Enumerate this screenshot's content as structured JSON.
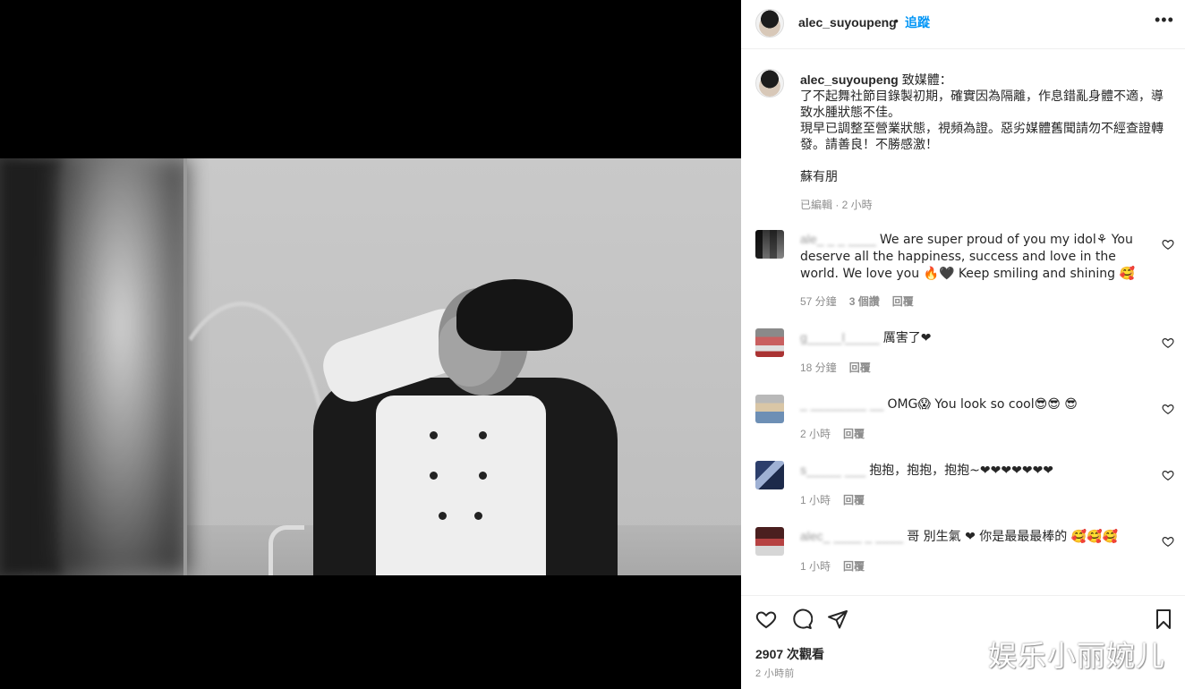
{
  "post": {
    "username": "alec_suyoupeng",
    "dot": "•",
    "follow_label": "追蹤",
    "more_label": "•••"
  },
  "caption": {
    "username": "alec_suyoupeng",
    "lines": [
      "致媒體：",
      "了不起舞社節目錄製初期，確實因為隔離，作息錯亂身體不適，導致水腫狀態不佳。",
      "現早已調整至營業狀態，視頻為證。惡劣媒體舊聞請勿不經查證轉發。請善良！不勝感激！",
      "",
      "蘇有朋"
    ],
    "meta": "已編輯 · 2 小時"
  },
  "comments": [
    {
      "name": "ale_ _ _ ____",
      "text": "We are super proud of you my idol⚘ You deserve all the happiness, success and love in the world. We love you 🔥🖤 Keep smiling and shining 🥰",
      "time": "57 分鐘",
      "likes": "3 個讚",
      "reply": "回覆"
    },
    {
      "name": "g_____l_____",
      "text": "厲害了❤",
      "time": "18 分鐘",
      "likes": "",
      "reply": "回覆"
    },
    {
      "name": "_ ________ __",
      "text": "OMG😱 You look so cool😎😎 😎",
      "time": "2 小時",
      "likes": "",
      "reply": "回覆"
    },
    {
      "name": "s_____ ___",
      "text": "抱抱，抱抱，抱抱~❤❤❤❤❤❤❤",
      "time": "1 小時",
      "likes": "",
      "reply": "回覆"
    },
    {
      "name": "alec_ ____ _ ____",
      "text": "哥 別生氣 ❤ 你是最最最棒的 🥰🥰🥰",
      "time": "1 小時",
      "likes": "",
      "reply": "回覆"
    }
  ],
  "actions": {
    "like_icon": "heart-icon",
    "comment_icon": "comment-icon",
    "share_icon": "share-icon",
    "save_icon": "bookmark-icon",
    "views": "2907 次觀看",
    "posted": "2 小時前"
  },
  "watermark": "娱乐小丽婉儿",
  "colors": {
    "accent": "#0095f6",
    "muted": "#8e8e8e",
    "text": "#262626",
    "heart_red": "#ed4956"
  }
}
